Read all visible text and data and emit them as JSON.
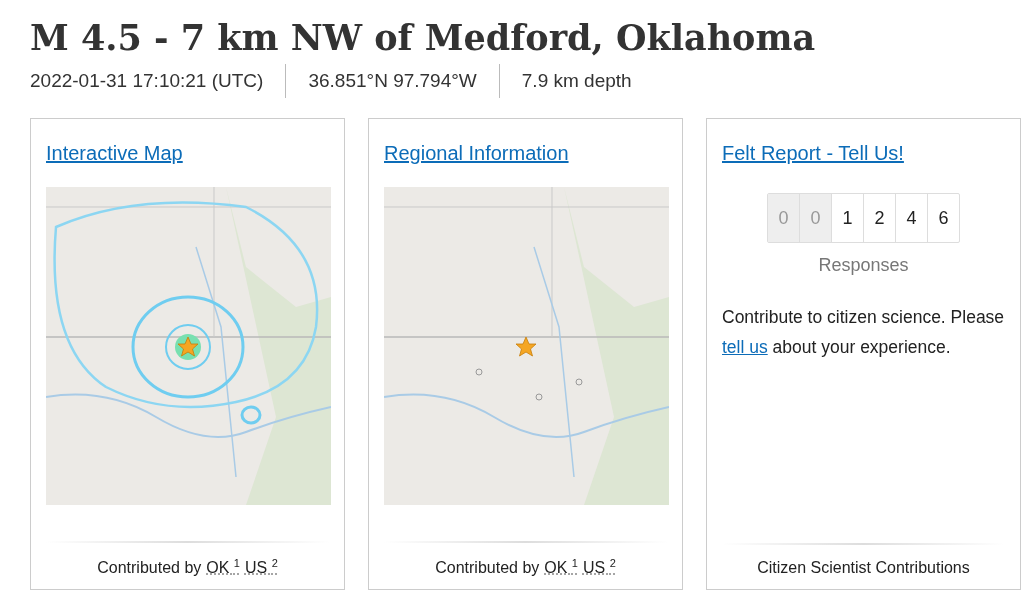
{
  "title": "M 4.5 - 7 km NW of Medford, Oklahoma",
  "meta": [
    "2022-01-31 17:10:21 (UTC)",
    "36.851°N 97.794°W",
    "7.9 km depth"
  ],
  "cards": [
    {
      "kind": "intensity-map",
      "title": "Interactive Map",
      "footer": {
        "prefix": "Contributed by",
        "sources": [
          {
            "code": "OK",
            "note": "1"
          },
          {
            "code": "US",
            "note": "2"
          }
        ]
      }
    },
    {
      "kind": "regional-map",
      "title": "Regional Information",
      "footer": {
        "prefix": "Contributed by",
        "sources": [
          {
            "code": "OK",
            "note": "1"
          },
          {
            "code": "US",
            "note": "2"
          }
        ]
      }
    },
    {
      "kind": "felt-report",
      "title": "Felt Report - Tell Us!",
      "counter": [
        {
          "digit": "0",
          "dimmed": true
        },
        {
          "digit": "0",
          "dimmed": true
        },
        {
          "digit": "1",
          "dimmed": false
        },
        {
          "digit": "2",
          "dimmed": false
        },
        {
          "digit": "4",
          "dimmed": false
        },
        {
          "digit": "6",
          "dimmed": false
        }
      ],
      "counter_label": "Responses",
      "text_before": "Contribute to citizen science. Please",
      "link": "tell us",
      "text_after": "about your experience.",
      "footer": {
        "prefix": "Citizen Scientist Contributions"
      }
    }
  ]
}
